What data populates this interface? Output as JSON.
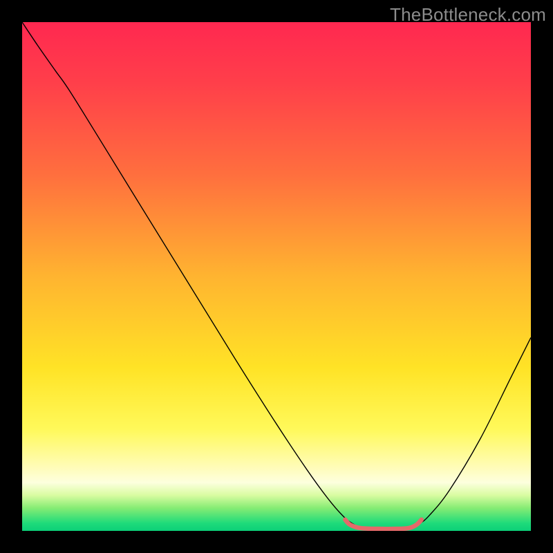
{
  "watermark": "TheBottleneck.com",
  "chart_data": {
    "type": "line",
    "title": "",
    "xlabel": "",
    "ylabel": "",
    "xlim": [
      0,
      100
    ],
    "ylim": [
      0,
      100
    ],
    "background_gradient_stops": [
      {
        "offset": 0.0,
        "color": "#ff2850"
      },
      {
        "offset": 0.12,
        "color": "#ff3f4a"
      },
      {
        "offset": 0.3,
        "color": "#ff6f3e"
      },
      {
        "offset": 0.5,
        "color": "#ffb430"
      },
      {
        "offset": 0.68,
        "color": "#ffe326"
      },
      {
        "offset": 0.8,
        "color": "#fff95a"
      },
      {
        "offset": 0.875,
        "color": "#fffcb8"
      },
      {
        "offset": 0.905,
        "color": "#fdffde"
      },
      {
        "offset": 0.93,
        "color": "#d9fca1"
      },
      {
        "offset": 0.955,
        "color": "#86ec74"
      },
      {
        "offset": 0.985,
        "color": "#1edb7a"
      },
      {
        "offset": 1.0,
        "color": "#0ccf78"
      }
    ],
    "series": [
      {
        "name": "bottleneck-curve",
        "color": "#000000",
        "width": 1.4,
        "points": [
          {
            "x": 0.0,
            "y": 100.0
          },
          {
            "x": 3.0,
            "y": 95.5
          },
          {
            "x": 6.5,
            "y": 90.5
          },
          {
            "x": 9.0,
            "y": 87.0
          },
          {
            "x": 14.0,
            "y": 79.0
          },
          {
            "x": 22.0,
            "y": 66.0
          },
          {
            "x": 32.0,
            "y": 49.8
          },
          {
            "x": 42.0,
            "y": 33.6
          },
          {
            "x": 50.0,
            "y": 21.0
          },
          {
            "x": 56.0,
            "y": 12.0
          },
          {
            "x": 60.0,
            "y": 6.5
          },
          {
            "x": 63.0,
            "y": 3.0
          },
          {
            "x": 65.0,
            "y": 1.4
          },
          {
            "x": 67.0,
            "y": 0.55
          },
          {
            "x": 70.0,
            "y": 0.35
          },
          {
            "x": 73.0,
            "y": 0.35
          },
          {
            "x": 76.0,
            "y": 0.55
          },
          {
            "x": 78.0,
            "y": 1.4
          },
          {
            "x": 80.0,
            "y": 3.0
          },
          {
            "x": 84.0,
            "y": 8.0
          },
          {
            "x": 90.0,
            "y": 18.0
          },
          {
            "x": 96.0,
            "y": 30.0
          },
          {
            "x": 100.0,
            "y": 38.0
          }
        ]
      },
      {
        "name": "optimal-flat-segment",
        "color": "#e46a6a",
        "width": 6.5,
        "linecap": "round",
        "points": [
          {
            "x": 63.5,
            "y": 2.2
          },
          {
            "x": 64.5,
            "y": 1.2
          },
          {
            "x": 66.5,
            "y": 0.55
          },
          {
            "x": 70.0,
            "y": 0.4
          },
          {
            "x": 73.5,
            "y": 0.4
          },
          {
            "x": 76.0,
            "y": 0.55
          },
          {
            "x": 77.5,
            "y": 1.2
          },
          {
            "x": 78.5,
            "y": 2.2
          }
        ]
      }
    ]
  }
}
